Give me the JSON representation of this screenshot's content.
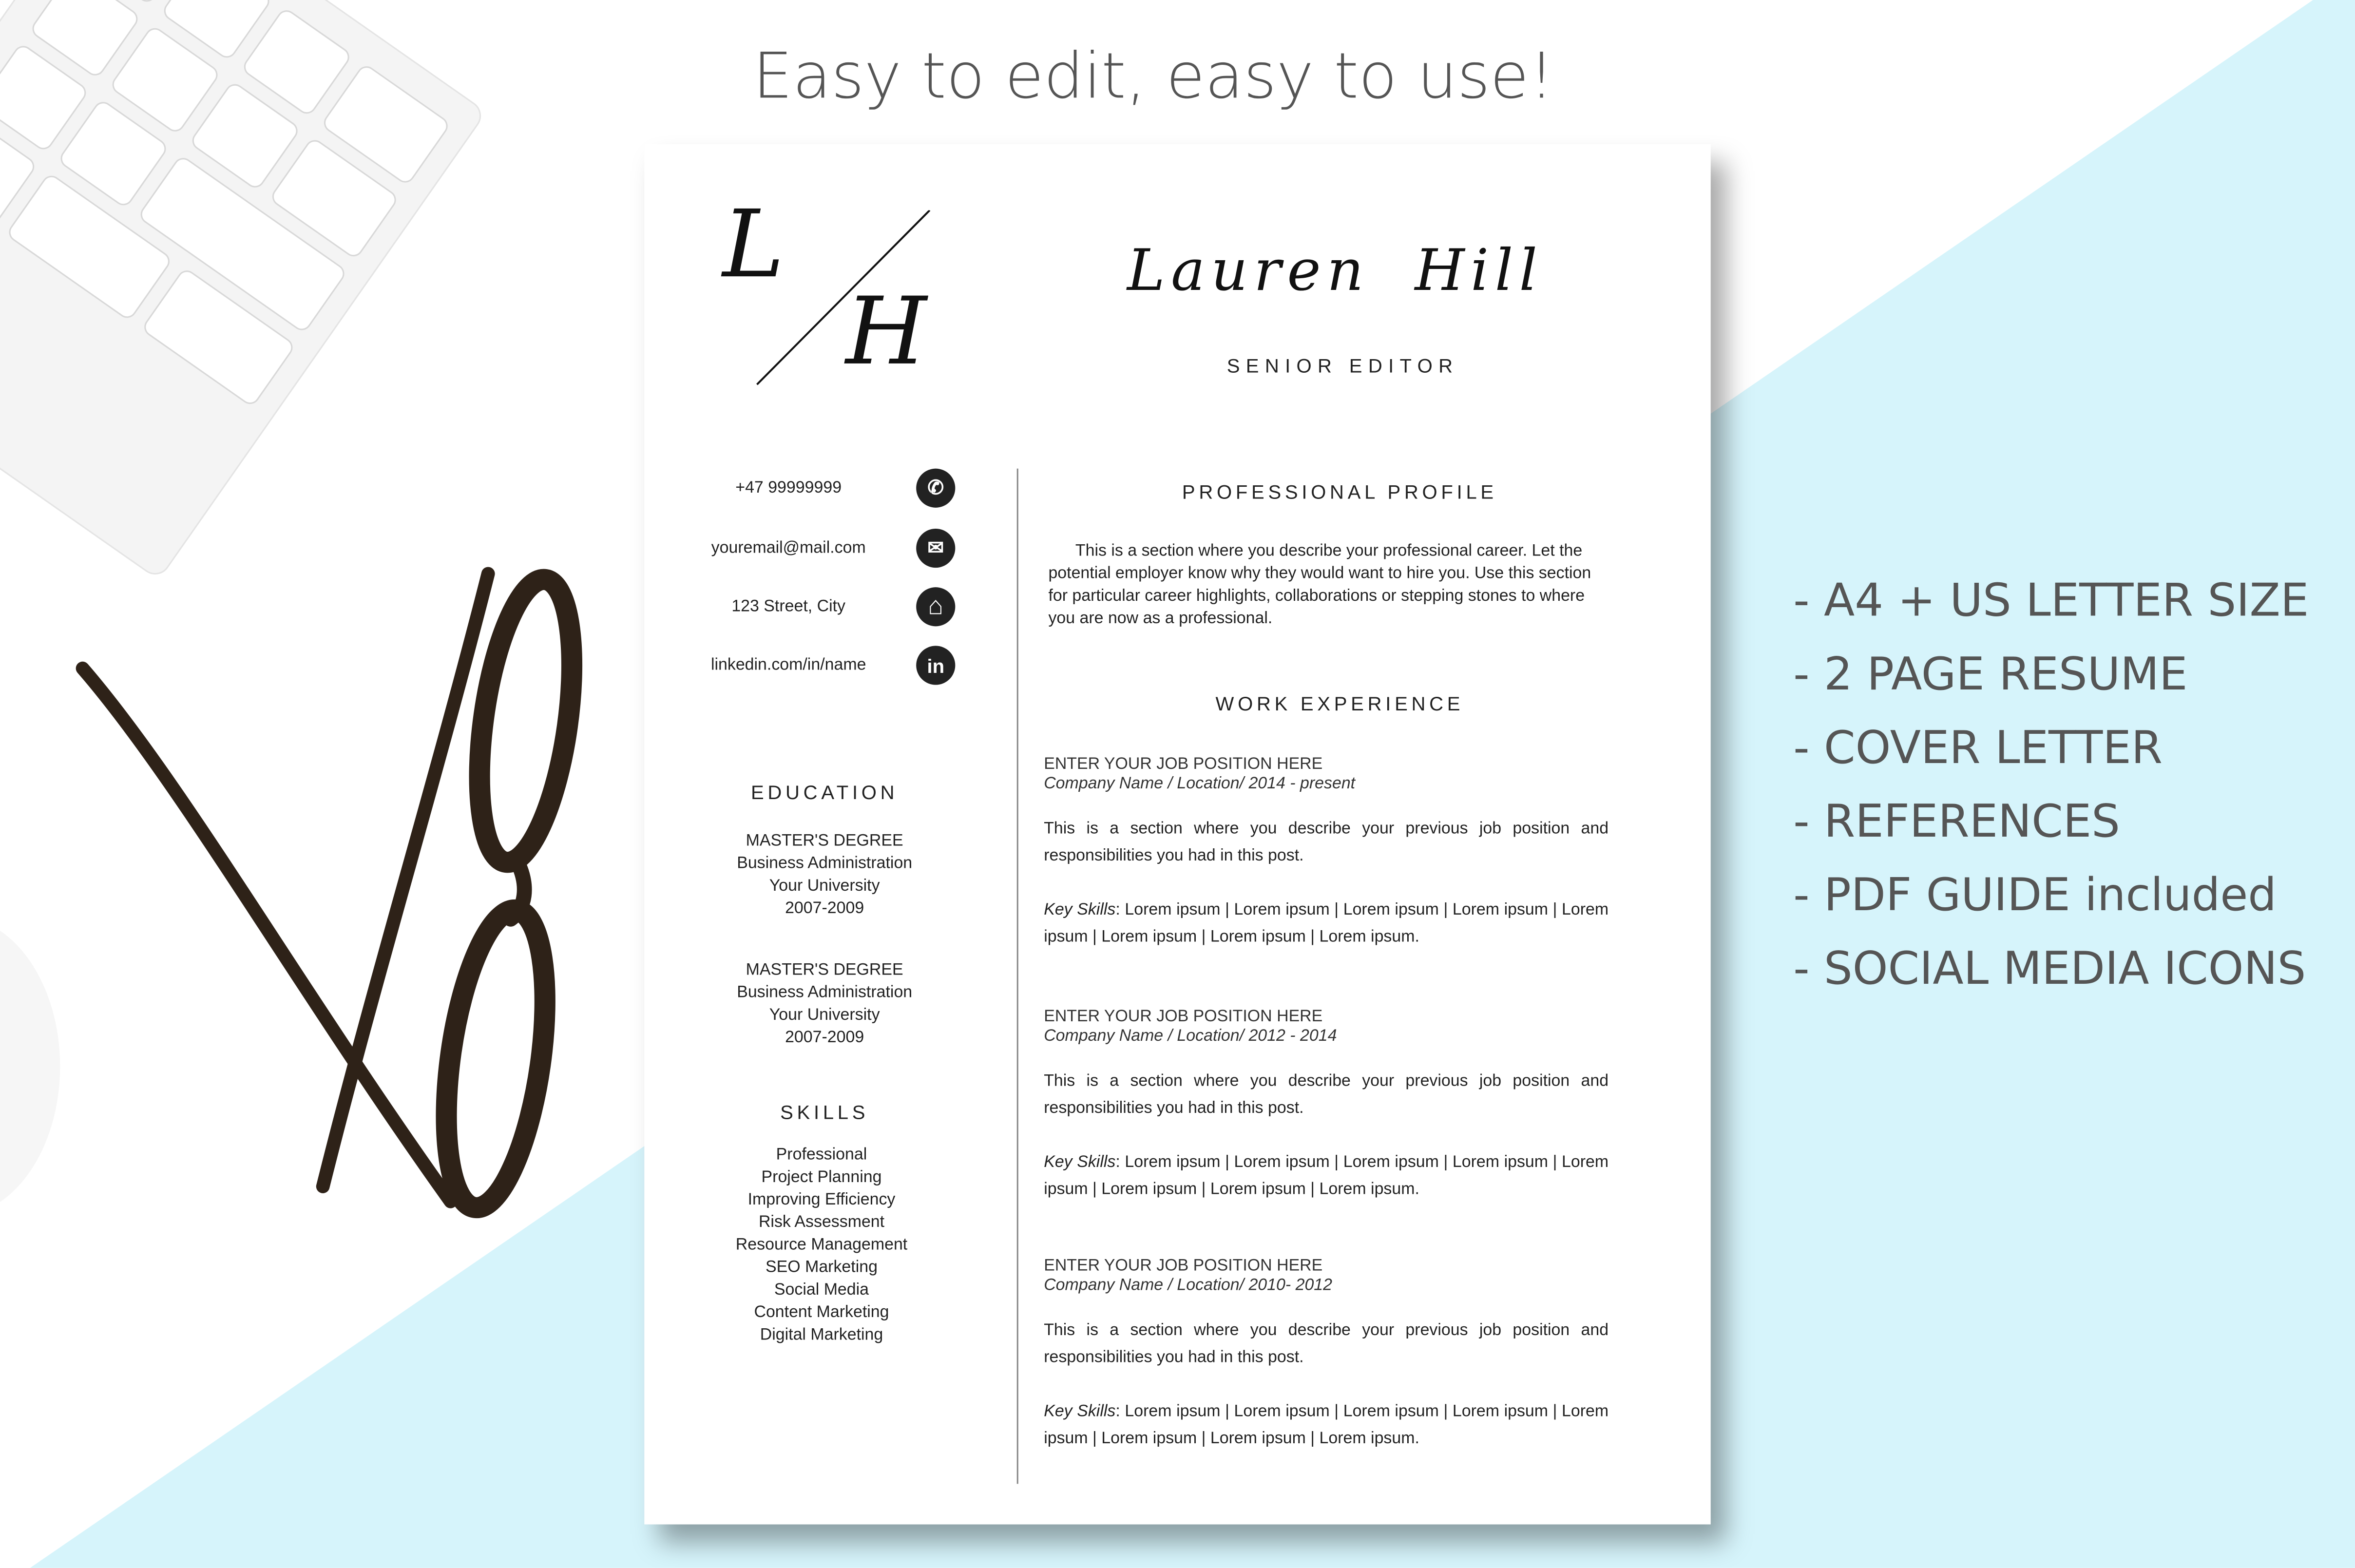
{
  "headline": "Easy to edit, easy to use!",
  "colors": {
    "background_accent": "#d6f4fb",
    "text_gray": "#555555",
    "icon_dark": "#222222"
  },
  "resume": {
    "monogram": {
      "first": "L",
      "last": "H"
    },
    "name": "Lauren Hill",
    "job_title": "SENIOR EDITOR",
    "contacts": [
      {
        "text": "+47 99999999",
        "icon": "phone-icon",
        "glyph": "✆"
      },
      {
        "text": "youremail@mail.com",
        "icon": "mail-icon",
        "glyph": "✉"
      },
      {
        "text": "123 Street, City",
        "icon": "home-icon",
        "glyph": "⌂"
      },
      {
        "text": "linkedin.com/in/name",
        "icon": "linkedin-icon",
        "glyph": "in"
      }
    ],
    "education": {
      "heading": "EDUCATION",
      "entries": [
        {
          "degree": "MASTER'S DEGREE",
          "field": "Business Administration",
          "school": "Your University",
          "years": "2007-2009"
        },
        {
          "degree": "MASTER'S DEGREE",
          "field": "Business Administration",
          "school": "Your University",
          "years": "2007-2009"
        }
      ]
    },
    "skills": {
      "heading": "SKILLS",
      "items": [
        "Professional",
        "Project Planning",
        "Improving Efficiency",
        "Risk Assessment",
        "Resource Management",
        "SEO Marketing",
        "Social Media",
        "Content Marketing",
        "Digital Marketing"
      ]
    },
    "profile": {
      "heading": "PROFESSIONAL PROFILE",
      "text": "This is a section where you describe your professional career. Let the potential employer know why they would want to hire you. Use this section for particular career highlights, collaborations or stepping stones to where you are now as a professional."
    },
    "work": {
      "heading": "WORK EXPERIENCE",
      "jobs": [
        {
          "position": "ENTER YOUR JOB POSITION HERE",
          "company": "Company Name / Location/ 2014 - present",
          "description": "This is a section where you describe your previous job position and responsibilities you had in this post.",
          "skills_label": "Key Skills",
          "skills": ": Lorem ipsum | Lorem ipsum | Lorem ipsum | Lorem ipsum | Lorem ipsum | Lorem ipsum | Lorem ipsum | Lorem ipsum."
        },
        {
          "position": "ENTER YOUR JOB POSITION HERE",
          "company": "Company Name / Location/ 2012 - 2014",
          "description": "This is a section where you describe your previous job position and responsibilities you had in this post.",
          "skills_label": "Key Skills",
          "skills": ": Lorem ipsum | Lorem ipsum | Lorem ipsum | Lorem ipsum | Lorem ipsum | Lorem ipsum | Lorem ipsum | Lorem ipsum."
        },
        {
          "position": "ENTER YOUR JOB POSITION HERE",
          "company": "Company Name / Location/ 2010- 2012",
          "description": "This is a section where you describe your previous job position and responsibilities you had in this post.",
          "skills_label": "Key Skills",
          "skills": ": Lorem ipsum | Lorem ipsum | Lorem ipsum | Lorem ipsum | Lorem ipsum | Lorem ipsum | Lorem ipsum | Lorem ipsum."
        }
      ]
    }
  },
  "features": [
    "- A4 + US LETTER SIZE",
    "- 2  PAGE RESUME",
    "- COVER LETTER",
    "- REFERENCES",
    "- PDF GUIDE included",
    "- SOCIAL MEDIA ICONS"
  ]
}
